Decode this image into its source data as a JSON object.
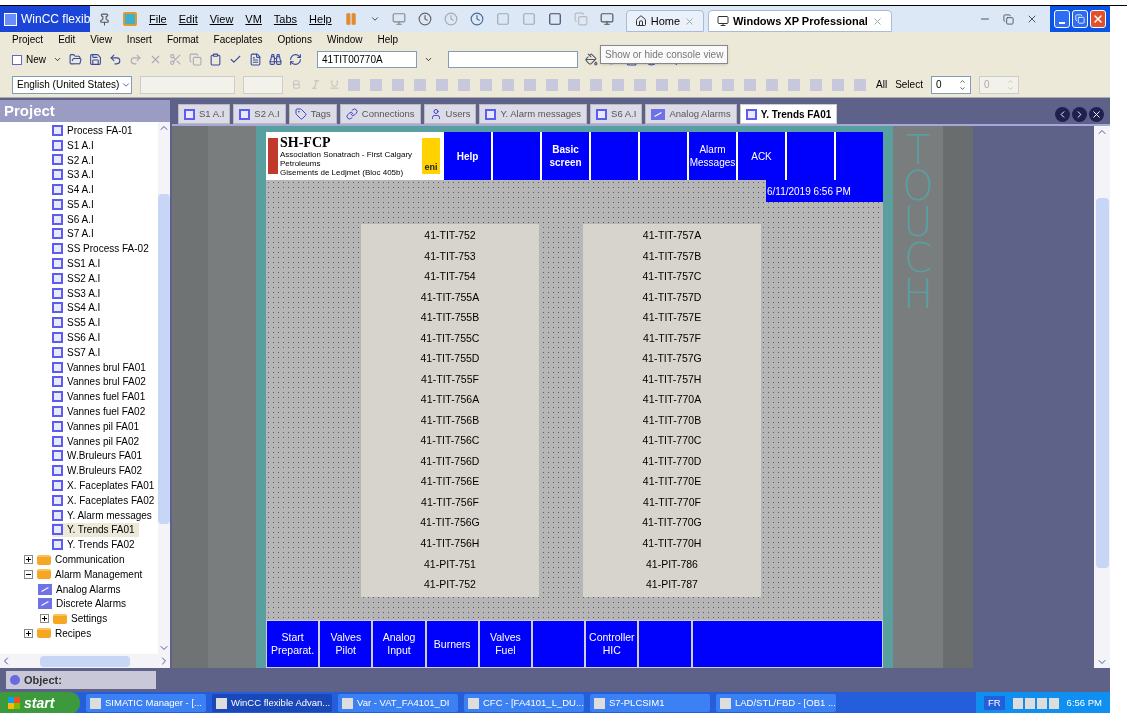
{
  "title_bar": {
    "app_title": "WinCC flexib",
    "menu": [
      "File",
      "Edit",
      "View",
      "VM",
      "Tabs",
      "Help"
    ],
    "vm_tabs": [
      {
        "label": "Home",
        "selected": false
      },
      {
        "label": "Windows XP Professional",
        "selected": true
      }
    ]
  },
  "menu_bar": [
    "Project",
    "Edit",
    "View",
    "Insert",
    "Format",
    "Faceplates",
    "Options",
    "Window",
    "Help"
  ],
  "toolbar": {
    "new_label": "New",
    "tag_field": "41TIT00770A",
    "tooltip": "Show or hide console view"
  },
  "format_bar": {
    "language": "English (United States)",
    "all_label": "All",
    "select_label": "Select",
    "spin_fields": [
      {
        "value": "0",
        "disabled": false
      },
      {
        "value": "0",
        "disabled": true
      }
    ]
  },
  "project": {
    "title": "Project",
    "screens": [
      {
        "label": "Process FA-01",
        "selected": false
      },
      {
        "label": "S1 A.I",
        "selected": false
      },
      {
        "label": "S2 A.I",
        "selected": false
      },
      {
        "label": "S3 A.I",
        "selected": false
      },
      {
        "label": "S4 A.I",
        "selected": false
      },
      {
        "label": "S5 A.I",
        "selected": false
      },
      {
        "label": "S6 A.I",
        "selected": false
      },
      {
        "label": "S7 A.I",
        "selected": false
      },
      {
        "label": "SS Process FA-02",
        "selected": false
      },
      {
        "label": "SS1 A.I",
        "selected": false
      },
      {
        "label": "SS2 A.I",
        "selected": false
      },
      {
        "label": "SS3 A.I",
        "selected": false
      },
      {
        "label": "SS4 A.I",
        "selected": false
      },
      {
        "label": "SS5 A.I",
        "selected": false
      },
      {
        "label": "SS6 A.I",
        "selected": false
      },
      {
        "label": "SS7 A.I",
        "selected": false
      },
      {
        "label": "Vannes brul FA01",
        "selected": false
      },
      {
        "label": "Vannes brul FA02",
        "selected": false
      },
      {
        "label": "Vannes fuel FA01",
        "selected": false
      },
      {
        "label": "Vannes fuel FA02",
        "selected": false
      },
      {
        "label": "Vannes pil FA01",
        "selected": false
      },
      {
        "label": "Vannes pil FA02",
        "selected": false
      },
      {
        "label": "W.Bruleurs FA01",
        "selected": false
      },
      {
        "label": "W.Bruleurs FA02",
        "selected": false
      },
      {
        "label": "X. Faceplates FA01",
        "selected": false
      },
      {
        "label": "X. Faceplates FA02",
        "selected": false
      },
      {
        "label": "Y. Alarm messages",
        "selected": false
      },
      {
        "label": "Y. Trends FA01",
        "selected": true
      },
      {
        "label": "Y. Trends FA02",
        "selected": false
      }
    ],
    "folders": [
      {
        "label": "Communication",
        "expanded": false
      },
      {
        "label": "Alarm Management",
        "expanded": true,
        "children": [
          {
            "label": "Analog Alarms",
            "kind": "alarm"
          },
          {
            "label": "Discrete Alarms",
            "kind": "alarm"
          },
          {
            "label": "Settings",
            "kind": "folder"
          }
        ]
      },
      {
        "label": "Recipes",
        "expanded": false
      }
    ]
  },
  "editor_tabs": [
    {
      "label": "S1 A.I",
      "kind": "screen",
      "selected": false
    },
    {
      "label": "S2 A.I",
      "kind": "screen",
      "selected": false
    },
    {
      "label": "Tags",
      "kind": "tags",
      "selected": false
    },
    {
      "label": "Connections",
      "kind": "connections",
      "selected": false
    },
    {
      "label": "Users",
      "kind": "users",
      "selected": false
    },
    {
      "label": "Y. Alarm messages",
      "kind": "screen",
      "selected": false
    },
    {
      "label": "S6 A.I",
      "kind": "screen",
      "selected": false
    },
    {
      "label": "Analog Alarms",
      "kind": "alarm",
      "selected": false
    },
    {
      "label": "Y. Trends FA01",
      "kind": "screen",
      "selected": true
    }
  ],
  "hmi": {
    "logo": {
      "title": "SH-FCP",
      "line_1": "Association Sonatrach - First Calgary Petroleums",
      "line_2": "Gisements de Ledjmet (Bloc 405b)",
      "brand": "eni"
    },
    "header_buttons": [
      {
        "kind": "text",
        "label": "Help",
        "bold": true
      },
      {
        "kind": "blank"
      },
      {
        "kind": "text",
        "label": "Basic\nscreen",
        "bold": true
      },
      {
        "kind": "blank"
      },
      {
        "kind": "blank"
      },
      {
        "kind": "text",
        "label": "Alarm\nMessages",
        "bold": false
      },
      {
        "kind": "text",
        "label": "ACK",
        "bold": false
      },
      {
        "kind": "blank"
      },
      {
        "kind": "blank"
      }
    ],
    "datetime": "6/11/2019 6:56 PM",
    "list_left": [
      "41-TIT-752",
      "41-TIT-753",
      "41-TIT-754",
      "41-TIT-755A",
      "41-TIT-755B",
      "41-TIT-755C",
      "41-TIT-755D",
      "41-TIT-755F",
      "41-TIT-756A",
      "41-TIT-756B",
      "41-TIT-756C",
      "41-TIT-756D",
      "41-TIT-756E",
      "41-TIT-756F",
      "41-TIT-756G",
      "41-TIT-756H",
      "41-PIT-751",
      "41-PIT-752"
    ],
    "list_right": [
      "41-TIT-757A",
      "41-TIT-757B",
      "41-TIT-757C",
      "41-TIT-757D",
      "41-TIT-757E",
      "41-TIT-757F",
      "41-TIT-757G",
      "41-TIT-757H",
      "41-TIT-770A",
      "41-TIT-770B",
      "41-TIT-770C",
      "41-TIT-770D",
      "41-TIT-770E",
      "41-TIT-770F",
      "41-TIT-770G",
      "41-TIT-770H",
      "41-PIT-786",
      "41-PIT-787"
    ],
    "footer_buttons": [
      {
        "kind": "text",
        "label": "Start\nPreparat.",
        "wide": false
      },
      {
        "kind": "text",
        "label": "Valves\nPilot",
        "wide": false
      },
      {
        "kind": "text",
        "label": "Analog\nInput",
        "wide": false
      },
      {
        "kind": "text",
        "label": "Burners",
        "wide": false
      },
      {
        "kind": "text",
        "label": "Valves\nFuel",
        "wide": false
      },
      {
        "kind": "blank",
        "wide": false
      },
      {
        "kind": "text",
        "label": "Controller\nHIC",
        "wide": false
      },
      {
        "kind": "blank",
        "wide": false
      },
      {
        "kind": "blank",
        "wide": true
      }
    ],
    "side_label": "TOUCH"
  },
  "object_bar": "Object:",
  "taskbar": {
    "start": "start",
    "items": [
      "SIMATIC Manager - [...",
      "WinCC flexible Advan...",
      "Var - VAT_FA4101_DI",
      "CFC - [FA4101_L_DU...",
      "S7-PLCSIM1",
      "LAD/STL/FBD  - [OB1 ..."
    ],
    "language": "FR",
    "clock": "6:56 PM"
  }
}
